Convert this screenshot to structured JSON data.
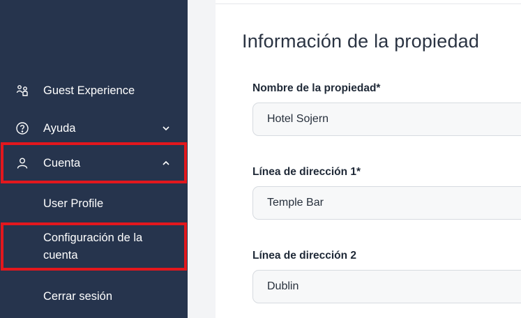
{
  "sidebar": {
    "background": "#26344d",
    "highlight_color": "#e3171d",
    "items": [
      {
        "label": "Guest Experience",
        "icon": "people-icon"
      },
      {
        "label": "Ayuda",
        "icon": "help-circle-icon",
        "chevron": "down"
      },
      {
        "label": "Cuenta",
        "icon": "user-icon",
        "chevron": "up"
      },
      {
        "label": "User Profile"
      },
      {
        "label": "Configuración de la cuenta"
      },
      {
        "label": "Cerrar sesión"
      }
    ]
  },
  "main": {
    "title": "Información de la propiedad",
    "fields": [
      {
        "label": "Nombre de la propiedad*",
        "value": "Hotel Sojern"
      },
      {
        "label": "Línea de dirección 1*",
        "value": "Temple Bar"
      },
      {
        "label": "Línea de dirección 2",
        "value": "Dublin"
      }
    ]
  }
}
